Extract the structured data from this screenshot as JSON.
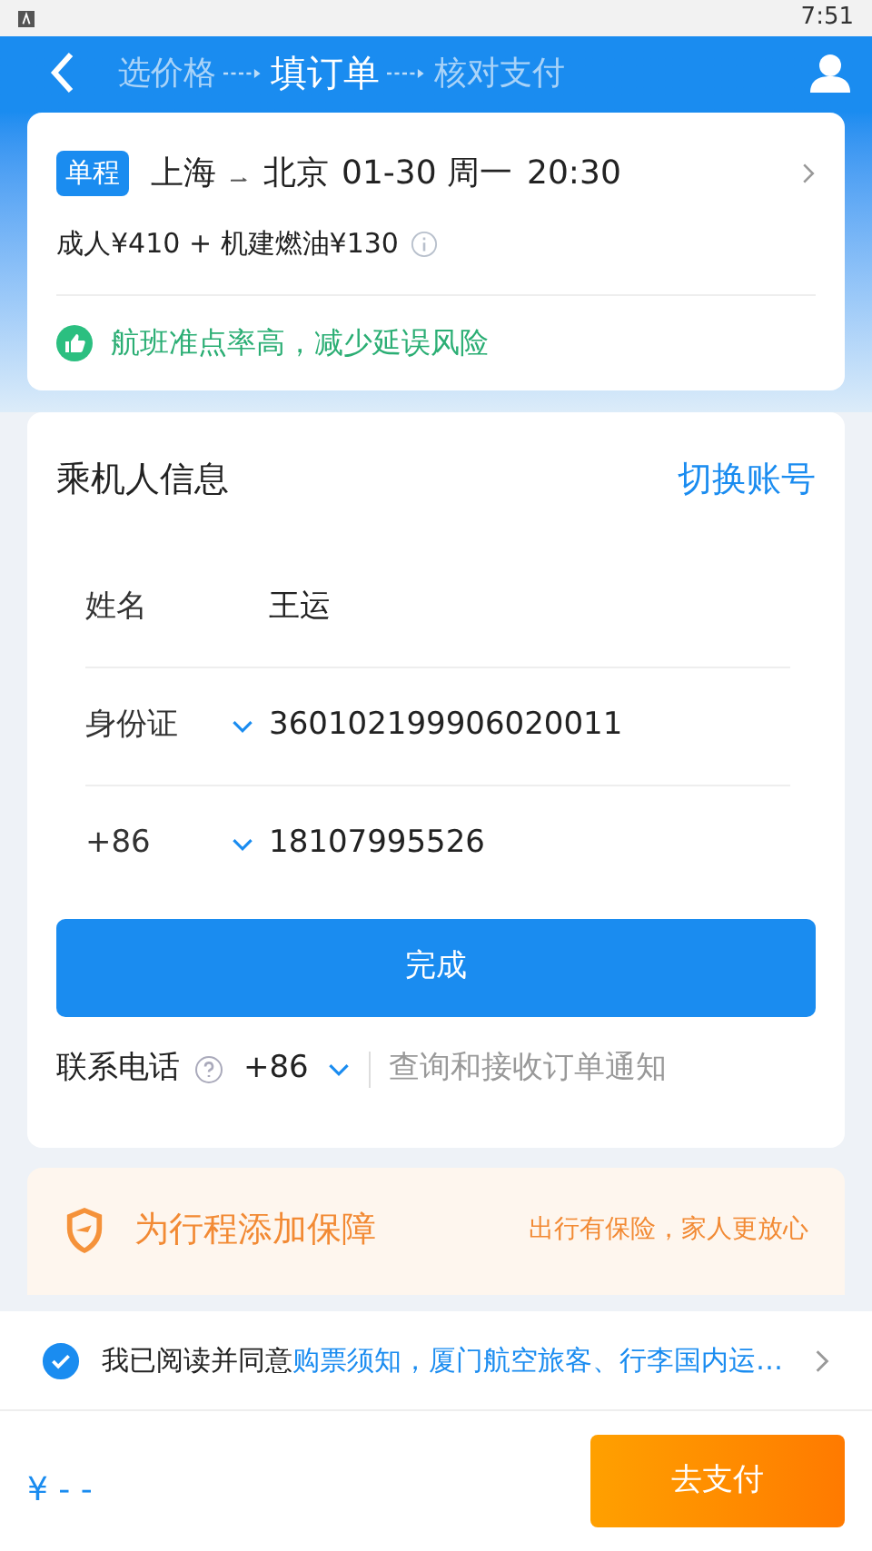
{
  "status_bar": {
    "time": "7:51"
  },
  "steps": [
    {
      "label": "选价格",
      "selected": false
    },
    {
      "label": "填订单",
      "selected": true
    },
    {
      "label": "核对支付",
      "selected": false
    }
  ],
  "flight": {
    "badge": "单程",
    "from": "上海",
    "to": "北京",
    "date": "01-30 周一",
    "time": "20:30",
    "price": "成人¥410 + 机建燃油¥130",
    "notice": "航班准点率高，减少延误风险"
  },
  "passenger": {
    "title": "乘机人信息",
    "switch_link": "切换账号",
    "rows": [
      {
        "label": "姓名",
        "value": "王运",
        "dropdown": false
      },
      {
        "label": "身份证",
        "value": "360102199906020011",
        "dropdown": true
      },
      {
        "label": "+86",
        "value": "18107995526",
        "dropdown": true
      }
    ],
    "done_button": "完成",
    "contact": {
      "label": "联系电话",
      "code": "+86",
      "placeholder": "查询和接收订单通知"
    }
  },
  "insurance": {
    "title": "为行程添加保障",
    "subtitle": "出行有保险，家人更放心"
  },
  "agreement": {
    "checked": true,
    "text": "我已阅读并同意",
    "link": "购票须知，厦门航空旅客、行李国内运…"
  },
  "footer": {
    "price": "¥ - -",
    "pay_button": "去支付"
  }
}
